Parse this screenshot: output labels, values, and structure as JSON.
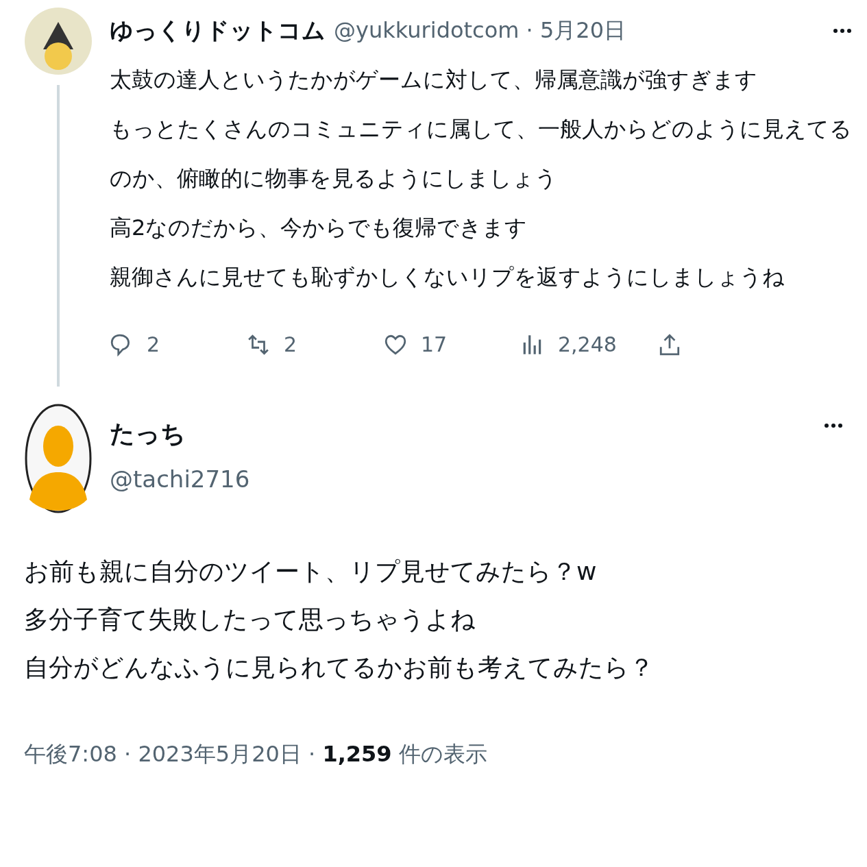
{
  "parent_tweet": {
    "name": "ゆっくりドットコム",
    "meta": "@yukkuridotcom · 5月20日",
    "lines": [
      "太鼓の達人というたかがゲームに対して、帰属意識が強すぎます",
      "もっとたくさんのコミュニティに属して、一般人からどのように見えてる",
      "のか、俯瞰的に物事を見るようにしましょう",
      "高2なのだから、今からでも復帰できます",
      "親御さんに見せても恥ずかしくないリプを返すようにしましょうね"
    ],
    "actions": [
      {
        "kind": "reply",
        "count": "2"
      },
      {
        "kind": "retweet",
        "count": "2"
      },
      {
        "kind": "like",
        "count": "17"
      },
      {
        "kind": "views",
        "count": "2,248"
      },
      {
        "kind": "share"
      }
    ]
  },
  "reply_tweet": {
    "name": "たっち",
    "handle": "@tachi2716",
    "lines": [
      "お前も親に自分のツイート、リプ見せてみたら？w",
      "多分子育て失敗したって思っちゃうよね",
      "自分がどんなふうに見られてるかお前も考えてみたら？"
    ],
    "footer": "午後7:08 · 2023年5月20日 · **1,259** 件の表示"
  }
}
